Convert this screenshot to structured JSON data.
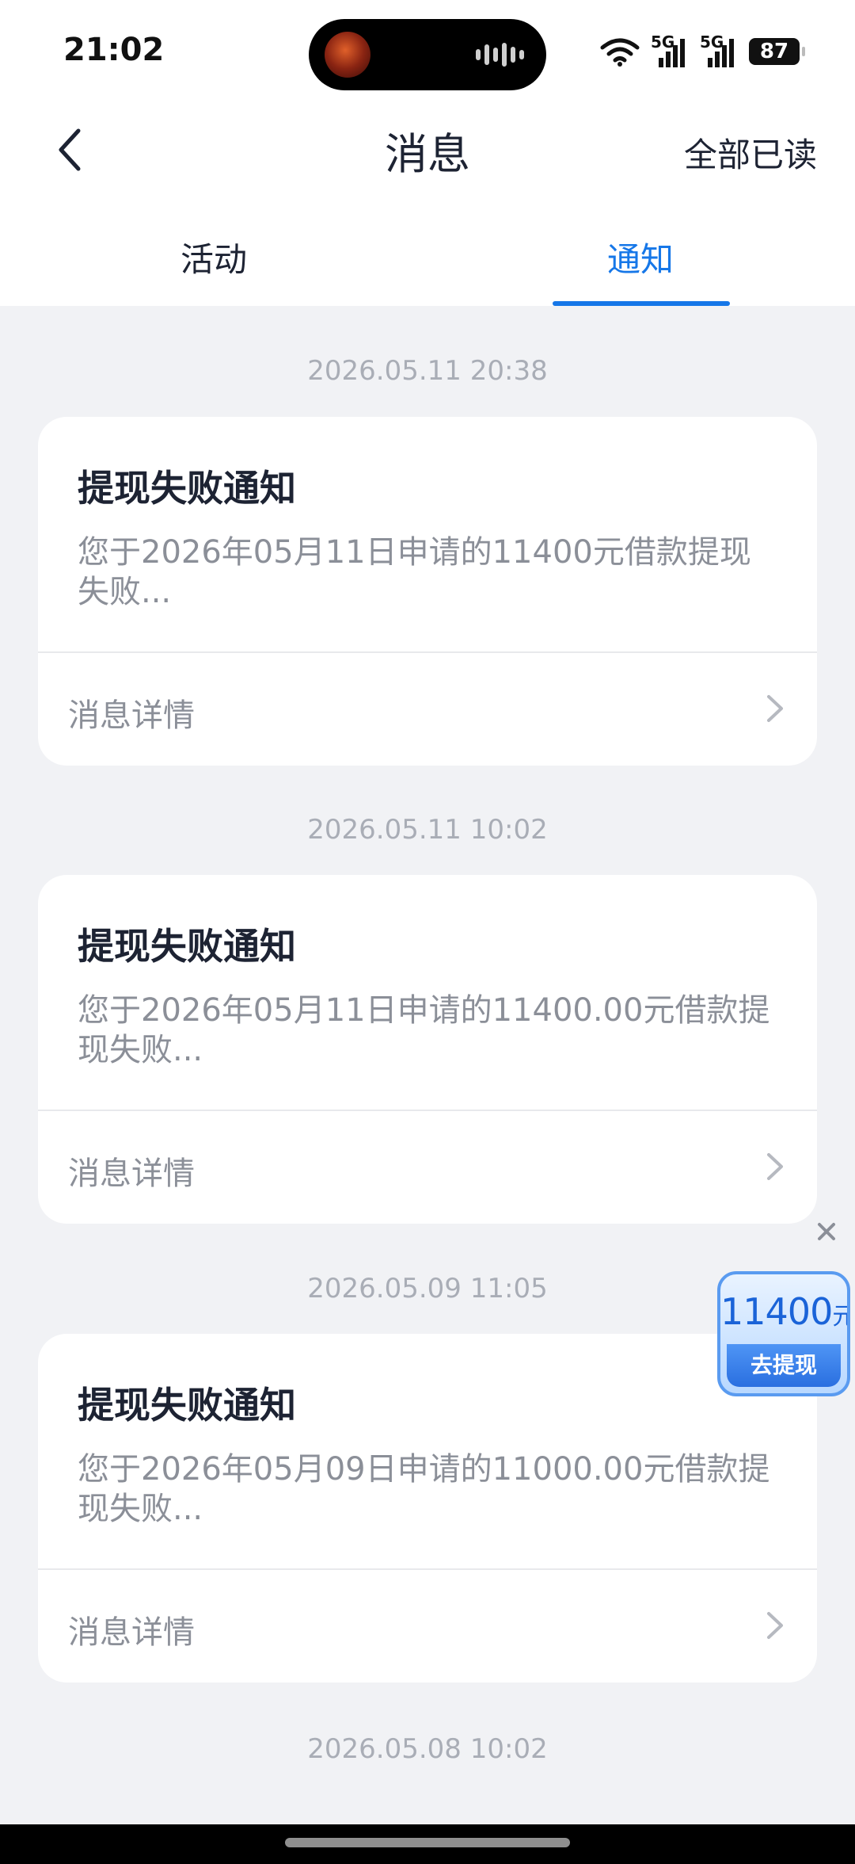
{
  "status_bar": {
    "time": "21:02",
    "battery": "87",
    "signal_1_label": "5G",
    "signal_2_label": "5G",
    "icons": [
      "wifi-icon",
      "signal-icon",
      "signal-icon",
      "battery-icon"
    ]
  },
  "header": {
    "title": "消息",
    "mark_all_read": "全部已读",
    "back_icon": "chevron-left-icon"
  },
  "tabs": [
    {
      "label": "活动",
      "active": false
    },
    {
      "label": "通知",
      "active": true
    }
  ],
  "accent_color": "#1677e8",
  "messages": [
    {
      "time": "2026.05.11 20:38",
      "title": "提现失败通知",
      "body": "您于2026年05月11日申请的11400元借款提现失败...",
      "detail_label": "消息详情"
    },
    {
      "time": "2026.05.11 10:02",
      "title": "提现失败通知",
      "body": "您于2026年05月11日申请的11400.00元借款提现失败...",
      "detail_label": "消息详情"
    },
    {
      "time": "2026.05.09 11:05",
      "title": "提现失败通知",
      "body": "您于2026年05月09日申请的11000.00元借款提现失败...",
      "detail_label": "消息详情"
    },
    {
      "time": "2026.05.08 10:02"
    }
  ],
  "promo": {
    "amount": "11400",
    "unit": "元",
    "action": "去提现",
    "close_icon": "close-icon"
  }
}
